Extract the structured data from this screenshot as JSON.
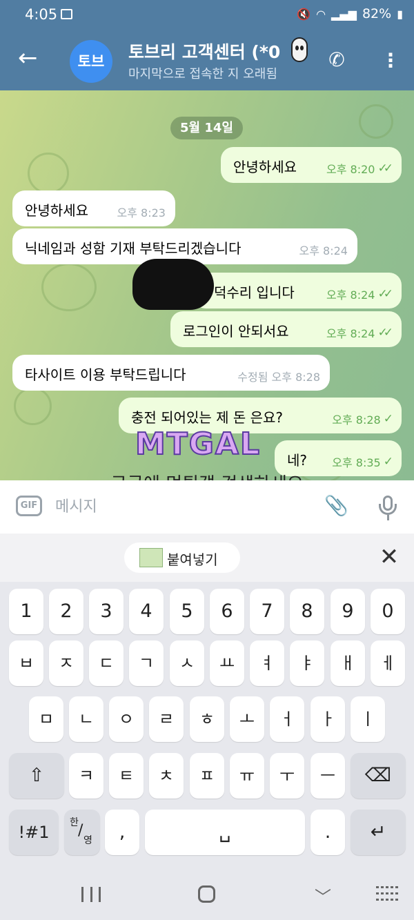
{
  "status_bar": {
    "time": "4:05",
    "battery": "82%"
  },
  "header": {
    "avatar_text": "토브",
    "title": "토브리 고객센터 (*0",
    "subtitle": "마지막으로 접속한 지 오래됨"
  },
  "chat": {
    "date_label": "5월 14일",
    "messages": [
      {
        "dir": "out",
        "text": "안녕하세요",
        "time": "오후 8:20",
        "status": "read"
      },
      {
        "dir": "in",
        "text": "안녕하세요",
        "time": "오후 8:23"
      },
      {
        "dir": "in",
        "text": "닉네임과 성함 기재 부탁드리겠습니다",
        "time": "오후 8:24"
      },
      {
        "dir": "out",
        "text": "덕수리 입니다",
        "time": "오후 8:24",
        "status": "read"
      },
      {
        "dir": "out",
        "text": "로그인이 안되서요",
        "time": "오후 8:24",
        "status": "read"
      },
      {
        "dir": "in",
        "text": "타사이트 이용 부탁드립니다",
        "time": "수정됨 오후 8:28"
      },
      {
        "dir": "out",
        "text": "충전 되어있는 제 돈 은요?",
        "time": "오후 8:28",
        "status": "sent"
      },
      {
        "dir": "out",
        "text": "네?",
        "time": "오후 8:35",
        "status": "sent"
      }
    ],
    "logo_text": "MTGAL",
    "watermark": "구글에 먹튀갤 검색하세요"
  },
  "input": {
    "gif_label": "GIF",
    "placeholder": "메시지"
  },
  "keyboard": {
    "paste_label": "붙여넣기",
    "number_row": [
      "1",
      "2",
      "3",
      "4",
      "5",
      "6",
      "7",
      "8",
      "9",
      "0"
    ],
    "row1": [
      "ㅂ",
      "ㅈ",
      "ㄷ",
      "ㄱ",
      "ㅅ",
      "ㅛ",
      "ㅕ",
      "ㅑ",
      "ㅐ",
      "ㅔ"
    ],
    "row2": [
      "ㅁ",
      "ㄴ",
      "ㅇ",
      "ㄹ",
      "ㅎ",
      "ㅗ",
      "ㅓ",
      "ㅏ",
      "ㅣ"
    ],
    "row3": [
      "ㅋ",
      "ㅌ",
      "ㅊ",
      "ㅍ",
      "ㅠ",
      "ㅜ",
      "ㅡ"
    ],
    "symbols_key": "!#1",
    "lang_key_top": "한",
    "lang_key_bottom": "영",
    "comma_key": ",",
    "period_key": "."
  },
  "colors": {
    "header": "#517da2",
    "out_bubble": "#effdde",
    "check": "#62ac55"
  }
}
